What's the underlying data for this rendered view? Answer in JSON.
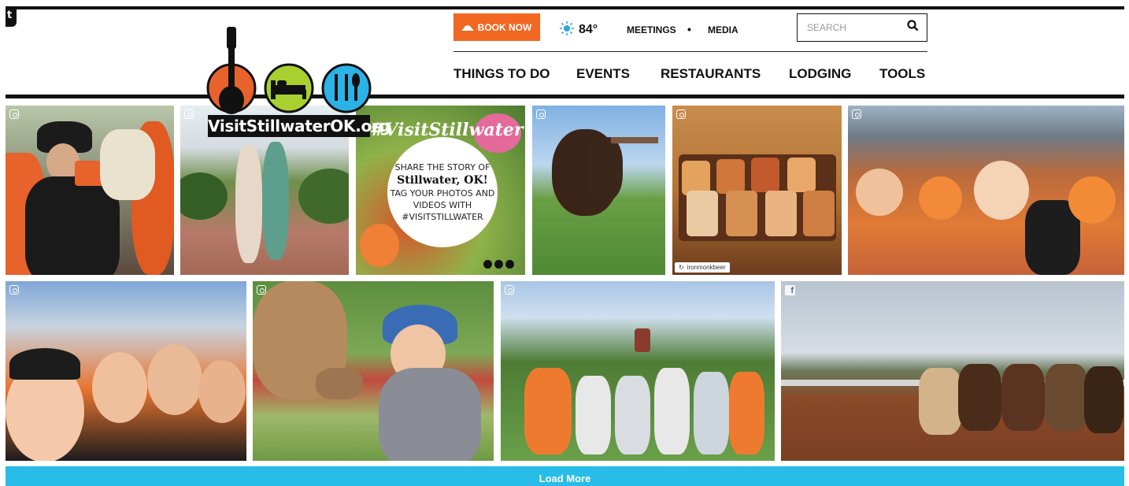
{
  "header": {
    "corner_tab_label": "t",
    "logo": {
      "text": "VisitStillwaterOK.org"
    },
    "book_now_label": "BOOK NOW",
    "weather": {
      "temperature": "84°",
      "icon": "sun-icon"
    },
    "utility_links": [
      {
        "label": "MEETINGS"
      },
      {
        "label": "MEDIA"
      }
    ],
    "utility_separator": "•",
    "search": {
      "placeholder": "SEARCH",
      "value": ""
    },
    "nav": [
      {
        "label": "THINGS TO DO"
      },
      {
        "label": "EVENTS"
      },
      {
        "label": "RESTAURANTS"
      },
      {
        "label": "LODGING"
      },
      {
        "label": "TOOLS"
      }
    ]
  },
  "colors": {
    "accent_orange": "#f26722",
    "load_more_blue": "#27bde8",
    "logo_orange": "#e8622c",
    "logo_green": "#a8d130",
    "logo_blue": "#2bb3e8"
  },
  "feed": {
    "tiles": [
      {
        "source": "instagram-icon",
        "subject": "man-in-cowboy-hat-photo"
      },
      {
        "source": "instagram-icon",
        "subject": "two-women-garden-path-photo"
      },
      {
        "source": "promo",
        "subject": "visitstillwater-promo-card"
      },
      {
        "source": "instagram-icon",
        "subject": "horse-in-field-photo"
      },
      {
        "source": "instagram-icon",
        "subject": "beer-flight-photo",
        "attribution": "ironmonkbeer"
      },
      {
        "source": "instagram-icon",
        "subject": "stadium-crowd-photo"
      },
      {
        "source": "instagram-icon",
        "subject": "marching-band-selfie-photo"
      },
      {
        "source": "instagram-icon",
        "subject": "woman-feeding-camel-photo"
      },
      {
        "source": "instagram-icon",
        "subject": "team-with-trophies-photo"
      },
      {
        "source": "facebook-icon",
        "subject": "rodeo-riders-photo"
      }
    ],
    "promo": {
      "hashtag": "#VisitStillwater",
      "line1": "SHARE THE STORY OF",
      "line2": "Stillwater, OK!",
      "line3": "TAG YOUR PHOTOS AND",
      "line4": "VIDEOS WITH",
      "line5": "#VISITSTILLWATER"
    },
    "load_more_label": "Load More"
  }
}
